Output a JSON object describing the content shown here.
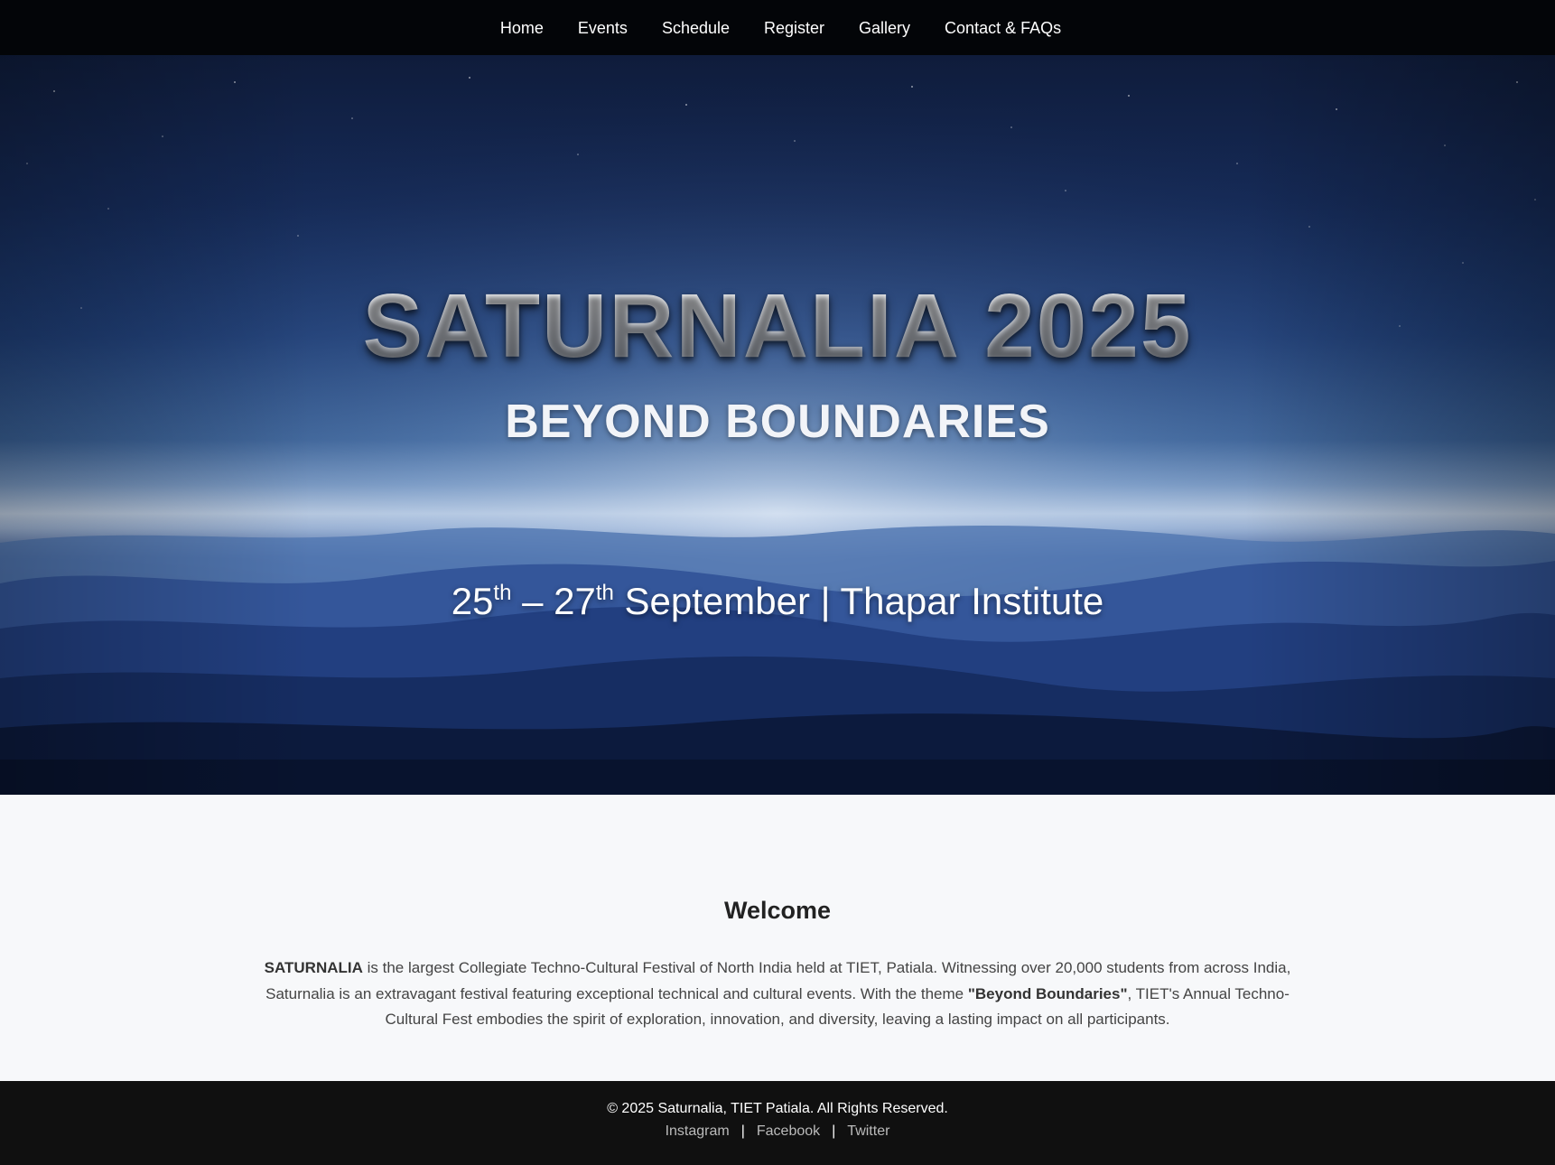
{
  "nav": {
    "items": [
      "Home",
      "Events",
      "Schedule",
      "Register",
      "Gallery",
      "Contact & FAQs"
    ]
  },
  "hero": {
    "title": "SATURNALIA 2025",
    "subtitle": "BEYOND BOUNDARIES",
    "date_start_day": "25",
    "date_start_suffix": "th",
    "date_sep": " – ",
    "date_end_day": "27",
    "date_end_suffix": "th",
    "date_rest": " September | Thapar Institute"
  },
  "welcome": {
    "title": "Welcome",
    "text_bold_1": "SATURNALIA",
    "text_part_1": " is the largest Collegiate Techno-Cultural Festival of North India held at TIET, Patiala. Witnessing over 20,000 students from across India, Saturnalia is an extravagant festival featuring exceptional technical and cultural events. With the theme ",
    "text_bold_2": "\"Beyond Boundaries\"",
    "text_part_2": ", TIET's Annual Techno-Cultural Fest embodies the spirit of exploration, innovation, and diversity, leaving a lasting impact on all participants."
  },
  "footer": {
    "copyright": "© 2025 Saturnalia, TIET Patiala. All Rights Reserved.",
    "social": [
      "Instagram",
      "Facebook",
      "Twitter"
    ],
    "separator": "|"
  },
  "colors": {
    "nav_bg": "#030508",
    "footer_bg": "#101010",
    "page_bg": "#f7f8fa",
    "hero_sky": "#1f3f78"
  }
}
